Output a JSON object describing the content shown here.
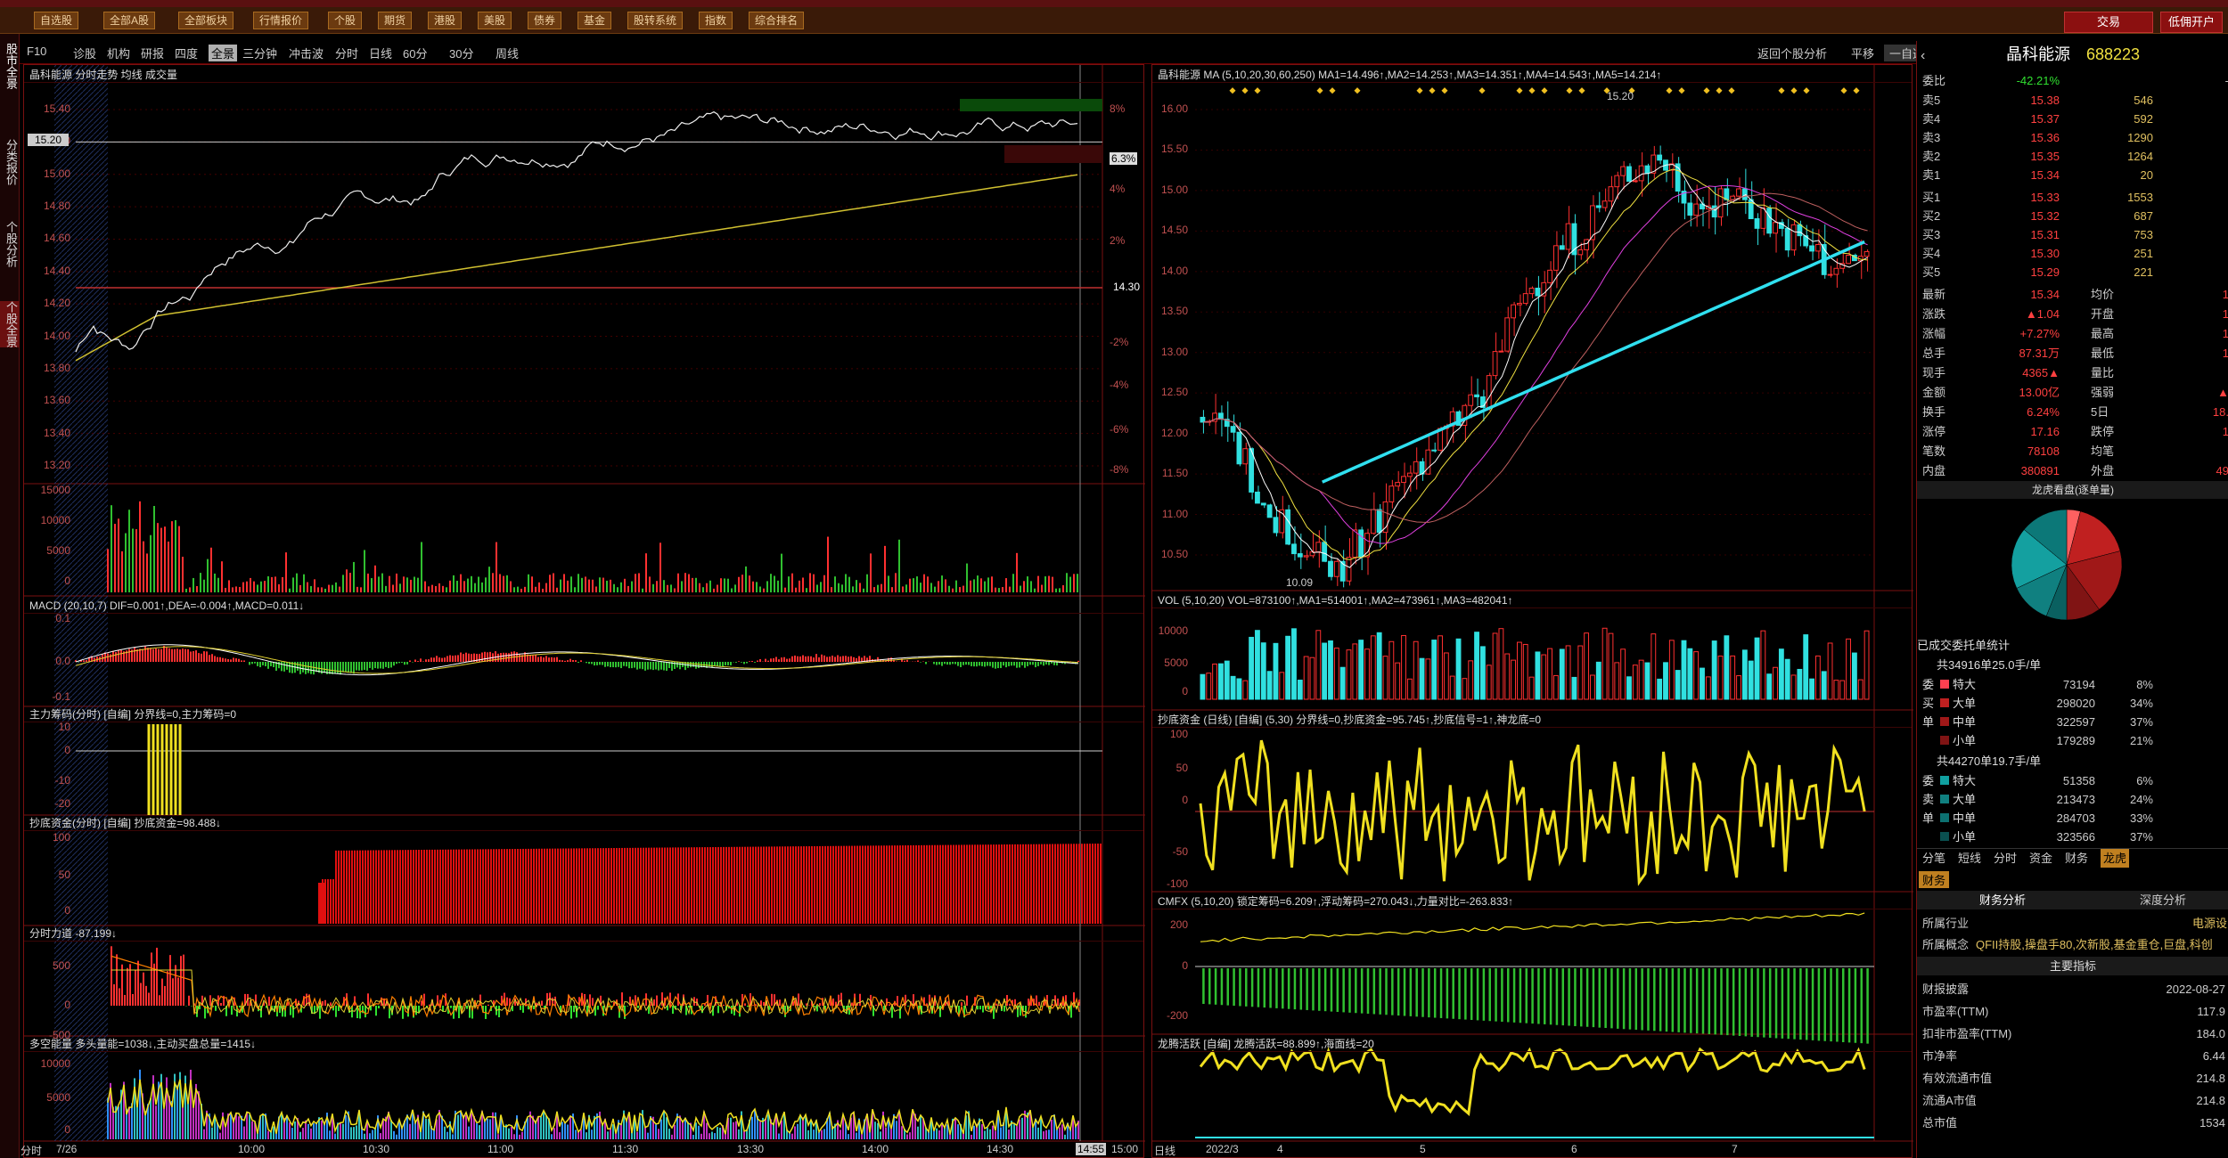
{
  "menu": {
    "items": [
      "自选股",
      "全部A股",
      "全部板块",
      "行情报价",
      "个股",
      "期货",
      "港股",
      "美股",
      "债券",
      "基金",
      "股转系统",
      "指数",
      "综合排名"
    ],
    "right_buttons": [
      "交易",
      "低佣开户"
    ]
  },
  "sidebar": {
    "tabs": [
      "股市全景",
      "分类报价",
      "个股分析",
      "个股全景"
    ]
  },
  "toolbar": {
    "left_items": [
      "F10",
      "诊股",
      "机构",
      "研报",
      "四度",
      "全景",
      "三分钟",
      "冲击波",
      "分时",
      "日线",
      "60分",
      "30分",
      "周线"
    ],
    "right_items": [
      "返回个股分析",
      "平移",
      "一自选"
    ]
  },
  "intraday": {
    "title": "晶科能源 分时走势 均线 成交量",
    "price_ticks": [
      "15.40",
      "15.20",
      "15.00",
      "14.80",
      "14.60",
      "14.40",
      "14.20",
      "14.00",
      "13.80",
      "13.60",
      "13.40",
      "13.20"
    ],
    "pct_ticks": [
      "8%",
      "6.3%",
      "4%",
      "2%",
      "-2%",
      "-4%",
      "-6%",
      "-8%"
    ],
    "ref_price": "14.30",
    "cursor_price": "15.20",
    "vol_ticks": [
      "15000",
      "10000",
      "5000",
      "0"
    ],
    "macd_title": "MACD (20,10,7) DIF=0.001↑,DEA=-0.004↑,MACD=0.011↓",
    "macd_ticks": [
      "0.1",
      "0.0",
      "-0.1"
    ],
    "zl_title": "主力筹码(分时) [自编] 分界线=0,主力筹码=0",
    "zl_ticks": [
      "10",
      "0",
      "-10",
      "-20"
    ],
    "cd_title": "抄底资金(分时) [自编] 抄底资金=98.488↓",
    "cd_ticks": [
      "100",
      "50",
      "0"
    ],
    "fs_title": "分时力道 -87.199↓",
    "fs_ticks": [
      "500",
      "0",
      "-500"
    ],
    "dk_title": "多空能量 多头量能=1038↓,主动买盘总量=1415↓",
    "dk_ticks": [
      "10000",
      "5000",
      "0"
    ],
    "time_ticks": [
      "7/26",
      "10:00",
      "10:30",
      "11:00",
      "11:30",
      "13:30",
      "14:00",
      "14:30",
      "14:55",
      "15:00"
    ],
    "time_label": "分时"
  },
  "daily": {
    "title": "晶科能源 MA (5,10,20,30,60,250) MA1=14.496↑,MA2=14.253↑,MA3=14.351↑,MA4=14.543↑,MA5=14.214↑",
    "price_ticks": [
      "16.00",
      "15.50",
      "15.00",
      "14.50",
      "14.00",
      "13.50",
      "13.00",
      "12.50",
      "12.00",
      "11.50",
      "11.00",
      "10.50"
    ],
    "high_label": "15.20",
    "low_label": "10.09",
    "vol_title": "VOL (5,10,20) VOL=873100↑,MA1=514001↑,MA2=473961↑,MA3=482041↑",
    "vol_ticks": [
      "10000",
      "5000",
      "0"
    ],
    "cd_title": "抄底资金 (日线) [自编] (5,30) 分界线=0,抄底资金=95.745↑,抄底信号=1↑,神龙底=0",
    "cd_ticks": [
      "100",
      "50",
      "0",
      "-50",
      "-100"
    ],
    "cmfx_title": "CMFX (5,10,20) 锁定筹码=6.209↑,浮动筹码=270.043↓,力量对比=-263.833↑",
    "cmfx_ticks": [
      "200",
      "0",
      "-200"
    ],
    "lt_title": "龙腾活跃 [自编] 龙腾活跃=88.899↑,海面线=20",
    "date_ticks": [
      "2022/3",
      "4",
      "5",
      "6",
      "7"
    ],
    "date_label": "日线"
  },
  "quote": {
    "name": "晶科能源",
    "code": "688223",
    "webi_label": "委比",
    "webi": "-42.21%",
    "webi_vol": "-",
    "asks": [
      {
        "label": "卖5",
        "price": "15.38",
        "vol": "546"
      },
      {
        "label": "卖4",
        "price": "15.37",
        "vol": "592"
      },
      {
        "label": "卖3",
        "price": "15.36",
        "vol": "1290"
      },
      {
        "label": "卖2",
        "price": "15.35",
        "vol": "1264"
      },
      {
        "label": "卖1",
        "price": "15.34",
        "vol": "20"
      }
    ],
    "bids": [
      {
        "label": "买1",
        "price": "15.33",
        "vol": "1553"
      },
      {
        "label": "买2",
        "price": "15.32",
        "vol": "687"
      },
      {
        "label": "买3",
        "price": "15.31",
        "vol": "753"
      },
      {
        "label": "买4",
        "price": "15.30",
        "vol": "251"
      },
      {
        "label": "买5",
        "price": "15.29",
        "vol": "221"
      }
    ],
    "stats": [
      {
        "l1": "最新",
        "v1": "15.34",
        "l2": "均价",
        "v2": "1"
      },
      {
        "l1": "涨跌",
        "v1": "▲1.04",
        "l2": "开盘",
        "v2": "1"
      },
      {
        "l1": "涨幅",
        "v1": "+7.27%",
        "l2": "最高",
        "v2": "1"
      },
      {
        "l1": "总手",
        "v1": "87.31万",
        "l2": "最低",
        "v2": "1"
      },
      {
        "l1": "现手",
        "v1": "4365▲",
        "l2": "量比",
        "v2": ""
      },
      {
        "l1": "金额",
        "v1": "13.00亿",
        "l2": "强弱",
        "v2": "▲"
      },
      {
        "l1": "换手",
        "v1": "6.24%",
        "l2": "5日",
        "v2": "18."
      },
      {
        "l1": "涨停",
        "v1": "17.16",
        "l2": "跌停",
        "v2": "1"
      },
      {
        "l1": "笔数",
        "v1": "78108",
        "l2": "均笔",
        "v2": ""
      },
      {
        "l1": "内盘",
        "v1": "380891",
        "l2": "外盘",
        "v2": "49"
      }
    ],
    "pie_title": "龙虎看盘(逐单量)",
    "stats_title": "已成交委托单统计",
    "buy_header": "共34916单25.0手/单",
    "buy_rows": [
      {
        "label": "特大",
        "vol": "73194",
        "pct": "8%"
      },
      {
        "label": "大单",
        "vol": "298020",
        "pct": "34%"
      },
      {
        "label": "中单",
        "vol": "322597",
        "pct": "37%"
      },
      {
        "label": "小单",
        "vol": "179289",
        "pct": "21%"
      }
    ],
    "buy_side": [
      "委",
      "买",
      "单"
    ],
    "sell_header": "共44270单19.7手/单",
    "sell_rows": [
      {
        "label": "特大",
        "vol": "51358",
        "pct": "6%"
      },
      {
        "label": "大单",
        "vol": "213473",
        "pct": "24%"
      },
      {
        "label": "中单",
        "vol": "284703",
        "pct": "33%"
      },
      {
        "label": "小单",
        "vol": "323566",
        "pct": "37%"
      }
    ],
    "sell_side": [
      "委",
      "卖",
      "单"
    ],
    "tabs": [
      "分笔",
      "短线",
      "分时",
      "资金",
      "财务",
      "龙虎"
    ],
    "fin_tab": "财务",
    "fin_subtabs": [
      "财务分析",
      "深度分析"
    ],
    "industry_label": "所属行业",
    "industry_value": "电源设",
    "concept_label": "所属概念",
    "concept_value": "QFII持股,操盘手80,次新股,基金重仓,巨盘,科创",
    "main_title": "主要指标",
    "fin_rows": [
      {
        "label": "财报披露",
        "value": "2022-08-27"
      },
      {
        "label": "市盈率(TTM)",
        "value": "117.9"
      },
      {
        "label": "扣非市盈率(TTM)",
        "value": "184.0"
      },
      {
        "label": "市净率",
        "value": "6.44"
      },
      {
        "label": "有效流通市值",
        "value": "214.8"
      },
      {
        "label": "流通A市值",
        "value": "214.8"
      },
      {
        "label": "总市值",
        "value": "1534"
      }
    ]
  }
}
